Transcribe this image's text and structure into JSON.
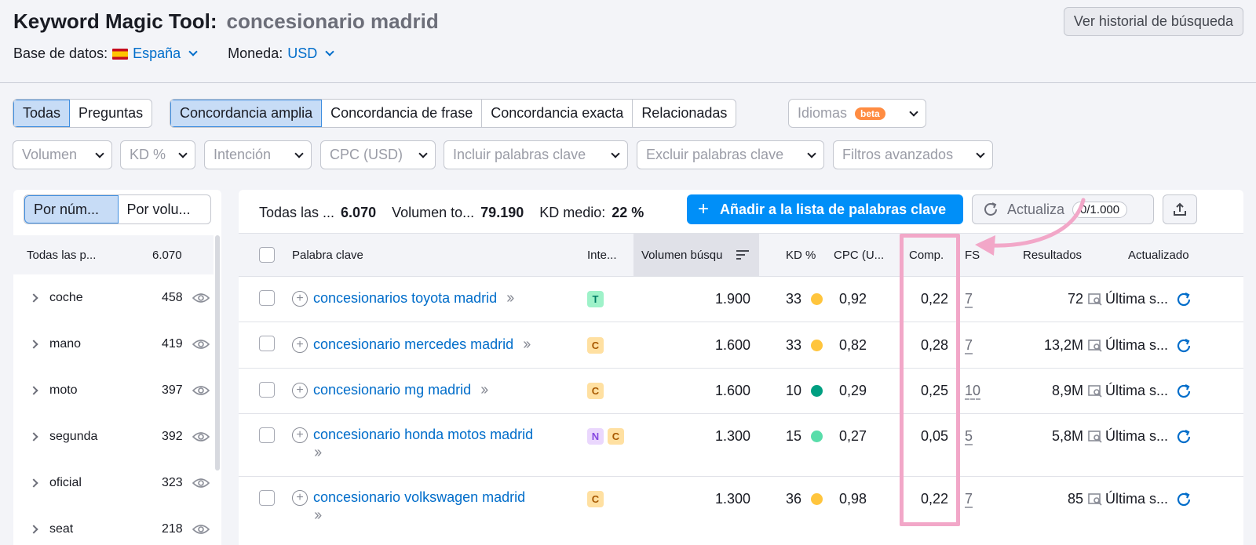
{
  "header": {
    "title": "Keyword Magic Tool:",
    "query": "concesionario madrid",
    "history_button": "Ver historial de búsqueda",
    "database_label": "Base de datos:",
    "database_value": "España",
    "currency_label": "Moneda:",
    "currency_value": "USD"
  },
  "match_tabs": {
    "scope": [
      "Todas",
      "Preguntas"
    ],
    "match": [
      "Concordancia amplia",
      "Concordancia de frase",
      "Concordancia exacta",
      "Relacionadas"
    ],
    "languages": "Idiomas",
    "beta": "beta"
  },
  "filters": [
    "Volumen",
    "KD %",
    "Intención",
    "CPC (USD)",
    "Incluir palabras clave",
    "Excluir palabras clave",
    "Filtros avanzados"
  ],
  "left_panel": {
    "toggle": [
      "Por núm...",
      "Por volu..."
    ],
    "header": {
      "name": "Todas las p...",
      "count": "6.070"
    },
    "groups": [
      {
        "name": "coche",
        "count": "458"
      },
      {
        "name": "mano",
        "count": "419"
      },
      {
        "name": "moto",
        "count": "397"
      },
      {
        "name": "segunda",
        "count": "392"
      },
      {
        "name": "oficial",
        "count": "323"
      },
      {
        "name": "seat",
        "count": "218"
      }
    ]
  },
  "summary": {
    "all_label": "Todas las ...",
    "all_value": "6.070",
    "volume_label": "Volumen to...",
    "volume_value": "79.190",
    "kd_label": "KD medio:",
    "kd_value": "22 %",
    "add_button": "Añadir a la lista de palabras clave",
    "update_button": "Actualiza",
    "update_count": "0/1.000"
  },
  "table": {
    "headers": {
      "keyword": "Palabra clave",
      "intent": "Inte...",
      "volume": "Volumen búsqu",
      "kd": "KD %",
      "cpc": "CPC (U...",
      "comp": "Comp.",
      "fs": "FS",
      "results": "Resultados",
      "updated": "Actualizado"
    },
    "rows": [
      {
        "keyword": "concesionarios toyota madrid",
        "intents": [
          "T"
        ],
        "volume": "1.900",
        "kd": "33",
        "kd_color": "#ffc53d",
        "cpc": "0,92",
        "comp": "0,22",
        "fs": "7",
        "results": "72",
        "updated": "Última s..."
      },
      {
        "keyword": "concesionario mercedes madrid",
        "intents": [
          "C"
        ],
        "volume": "1.600",
        "kd": "33",
        "kd_color": "#ffc53d",
        "cpc": "0,82",
        "comp": "0,28",
        "fs": "7",
        "results": "13,2M",
        "updated": "Última s..."
      },
      {
        "keyword": "concesionario mg madrid",
        "intents": [
          "C"
        ],
        "volume": "1.600",
        "kd": "10",
        "kd_color": "#009f81",
        "cpc": "0,29",
        "comp": "0,25",
        "fs": "10",
        "results": "8,9M",
        "updated": "Última s..."
      },
      {
        "keyword": "concesionario honda motos madrid",
        "intents": [
          "N",
          "C"
        ],
        "volume": "1.300",
        "kd": "15",
        "kd_color": "#59ddaa",
        "cpc": "0,27",
        "comp": "0,05",
        "fs": "5",
        "results": "5,8M",
        "updated": "Última s..."
      },
      {
        "keyword": "concesionario volkswagen madrid",
        "intents": [
          "C"
        ],
        "volume": "1.300",
        "kd": "36",
        "kd_color": "#ffc53d",
        "cpc": "0,98",
        "comp": "0,22",
        "fs": "7",
        "results": "85",
        "updated": "Última s..."
      }
    ]
  },
  "colors": {
    "accent": "#008ff8",
    "link": "#006dca",
    "highlight": "#f2a7c8"
  }
}
